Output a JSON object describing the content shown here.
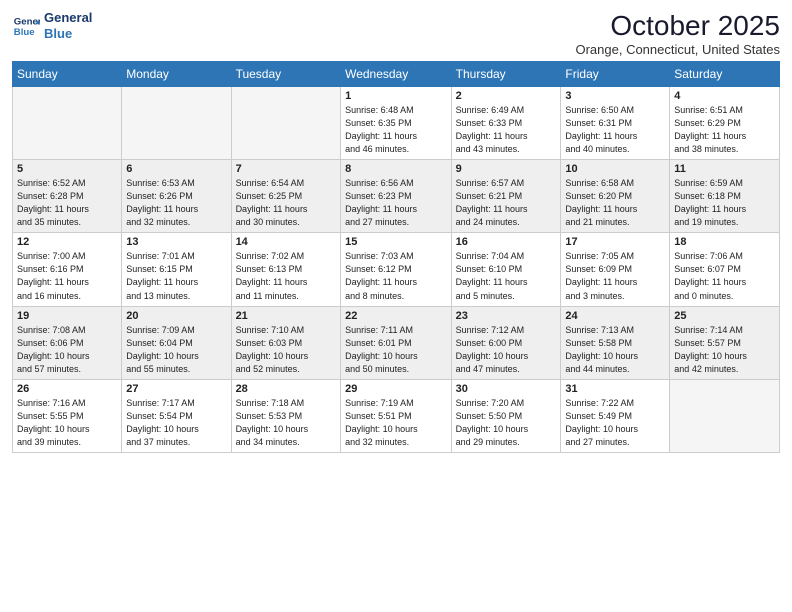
{
  "header": {
    "logo_line1": "General",
    "logo_line2": "Blue",
    "month": "October 2025",
    "location": "Orange, Connecticut, United States"
  },
  "weekdays": [
    "Sunday",
    "Monday",
    "Tuesday",
    "Wednesday",
    "Thursday",
    "Friday",
    "Saturday"
  ],
  "weeks": [
    [
      {
        "day": "",
        "info": ""
      },
      {
        "day": "",
        "info": ""
      },
      {
        "day": "",
        "info": ""
      },
      {
        "day": "1",
        "info": "Sunrise: 6:48 AM\nSunset: 6:35 PM\nDaylight: 11 hours\nand 46 minutes."
      },
      {
        "day": "2",
        "info": "Sunrise: 6:49 AM\nSunset: 6:33 PM\nDaylight: 11 hours\nand 43 minutes."
      },
      {
        "day": "3",
        "info": "Sunrise: 6:50 AM\nSunset: 6:31 PM\nDaylight: 11 hours\nand 40 minutes."
      },
      {
        "day": "4",
        "info": "Sunrise: 6:51 AM\nSunset: 6:29 PM\nDaylight: 11 hours\nand 38 minutes."
      }
    ],
    [
      {
        "day": "5",
        "info": "Sunrise: 6:52 AM\nSunset: 6:28 PM\nDaylight: 11 hours\nand 35 minutes."
      },
      {
        "day": "6",
        "info": "Sunrise: 6:53 AM\nSunset: 6:26 PM\nDaylight: 11 hours\nand 32 minutes."
      },
      {
        "day": "7",
        "info": "Sunrise: 6:54 AM\nSunset: 6:25 PM\nDaylight: 11 hours\nand 30 minutes."
      },
      {
        "day": "8",
        "info": "Sunrise: 6:56 AM\nSunset: 6:23 PM\nDaylight: 11 hours\nand 27 minutes."
      },
      {
        "day": "9",
        "info": "Sunrise: 6:57 AM\nSunset: 6:21 PM\nDaylight: 11 hours\nand 24 minutes."
      },
      {
        "day": "10",
        "info": "Sunrise: 6:58 AM\nSunset: 6:20 PM\nDaylight: 11 hours\nand 21 minutes."
      },
      {
        "day": "11",
        "info": "Sunrise: 6:59 AM\nSunset: 6:18 PM\nDaylight: 11 hours\nand 19 minutes."
      }
    ],
    [
      {
        "day": "12",
        "info": "Sunrise: 7:00 AM\nSunset: 6:16 PM\nDaylight: 11 hours\nand 16 minutes."
      },
      {
        "day": "13",
        "info": "Sunrise: 7:01 AM\nSunset: 6:15 PM\nDaylight: 11 hours\nand 13 minutes."
      },
      {
        "day": "14",
        "info": "Sunrise: 7:02 AM\nSunset: 6:13 PM\nDaylight: 11 hours\nand 11 minutes."
      },
      {
        "day": "15",
        "info": "Sunrise: 7:03 AM\nSunset: 6:12 PM\nDaylight: 11 hours\nand 8 minutes."
      },
      {
        "day": "16",
        "info": "Sunrise: 7:04 AM\nSunset: 6:10 PM\nDaylight: 11 hours\nand 5 minutes."
      },
      {
        "day": "17",
        "info": "Sunrise: 7:05 AM\nSunset: 6:09 PM\nDaylight: 11 hours\nand 3 minutes."
      },
      {
        "day": "18",
        "info": "Sunrise: 7:06 AM\nSunset: 6:07 PM\nDaylight: 11 hours\nand 0 minutes."
      }
    ],
    [
      {
        "day": "19",
        "info": "Sunrise: 7:08 AM\nSunset: 6:06 PM\nDaylight: 10 hours\nand 57 minutes."
      },
      {
        "day": "20",
        "info": "Sunrise: 7:09 AM\nSunset: 6:04 PM\nDaylight: 10 hours\nand 55 minutes."
      },
      {
        "day": "21",
        "info": "Sunrise: 7:10 AM\nSunset: 6:03 PM\nDaylight: 10 hours\nand 52 minutes."
      },
      {
        "day": "22",
        "info": "Sunrise: 7:11 AM\nSunset: 6:01 PM\nDaylight: 10 hours\nand 50 minutes."
      },
      {
        "day": "23",
        "info": "Sunrise: 7:12 AM\nSunset: 6:00 PM\nDaylight: 10 hours\nand 47 minutes."
      },
      {
        "day": "24",
        "info": "Sunrise: 7:13 AM\nSunset: 5:58 PM\nDaylight: 10 hours\nand 44 minutes."
      },
      {
        "day": "25",
        "info": "Sunrise: 7:14 AM\nSunset: 5:57 PM\nDaylight: 10 hours\nand 42 minutes."
      }
    ],
    [
      {
        "day": "26",
        "info": "Sunrise: 7:16 AM\nSunset: 5:55 PM\nDaylight: 10 hours\nand 39 minutes."
      },
      {
        "day": "27",
        "info": "Sunrise: 7:17 AM\nSunset: 5:54 PM\nDaylight: 10 hours\nand 37 minutes."
      },
      {
        "day": "28",
        "info": "Sunrise: 7:18 AM\nSunset: 5:53 PM\nDaylight: 10 hours\nand 34 minutes."
      },
      {
        "day": "29",
        "info": "Sunrise: 7:19 AM\nSunset: 5:51 PM\nDaylight: 10 hours\nand 32 minutes."
      },
      {
        "day": "30",
        "info": "Sunrise: 7:20 AM\nSunset: 5:50 PM\nDaylight: 10 hours\nand 29 minutes."
      },
      {
        "day": "31",
        "info": "Sunrise: 7:22 AM\nSunset: 5:49 PM\nDaylight: 10 hours\nand 27 minutes."
      },
      {
        "day": "",
        "info": ""
      }
    ]
  ]
}
